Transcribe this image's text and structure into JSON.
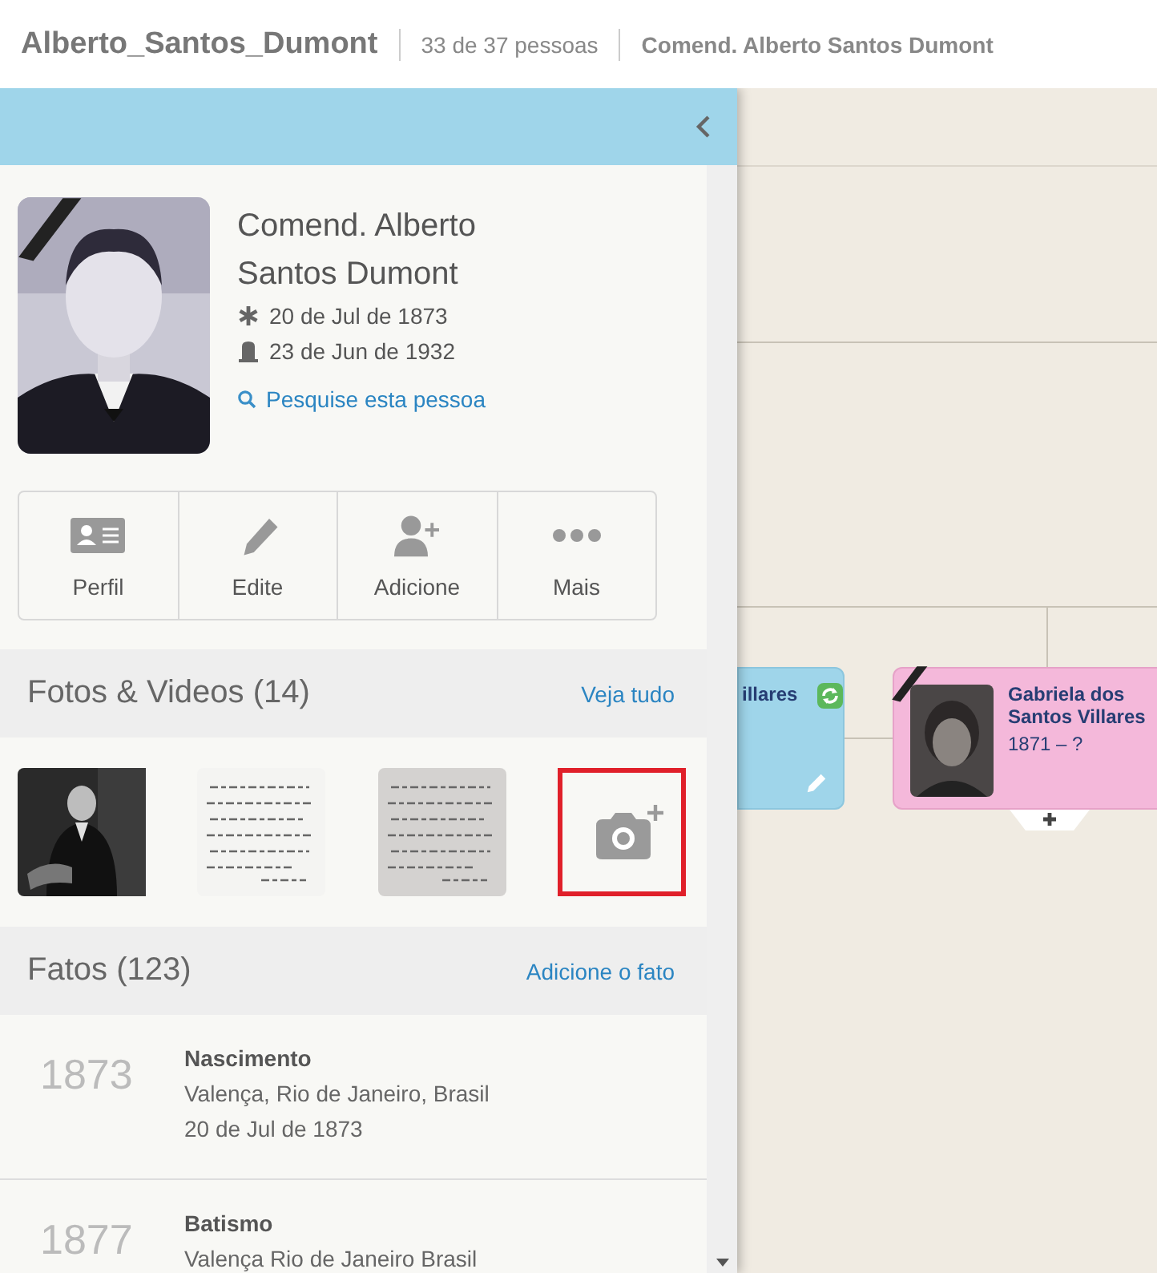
{
  "header": {
    "title": "Alberto_Santos_Dumont",
    "count": "33 de 37 pessoas",
    "person": "Comend. Alberto Santos Dumont"
  },
  "profile": {
    "name": "Comend. Alberto Santos Dumont",
    "deceased": true,
    "birth": "20 de Jul de 1873",
    "death": "23 de Jun de 1932",
    "search_link": "Pesquise esta pessoa"
  },
  "actions": [
    {
      "label": "Perfil",
      "kind": "profile"
    },
    {
      "label": "Edite",
      "kind": "edit"
    },
    {
      "label": "Adicione",
      "kind": "add"
    },
    {
      "label": "Mais",
      "kind": "more"
    }
  ],
  "photos": {
    "title": "Fotos & Videos (14)",
    "link": "Veja tudo",
    "items": [
      {
        "kind": "portrait",
        "highlighted": false
      },
      {
        "kind": "document",
        "highlighted": false
      },
      {
        "kind": "letter",
        "highlighted": false
      },
      {
        "kind": "add",
        "highlighted": true
      }
    ]
  },
  "facts": {
    "title": "Fatos (123)",
    "link": "Adicione o fato",
    "items": [
      {
        "year": "1873",
        "event": "Nascimento",
        "lines": [
          "Valença, Rio de Janeiro, Brasil",
          "20 de Jul de 1873"
        ]
      },
      {
        "year": "1877",
        "event": "Batismo",
        "lines": [
          "Valença Rio de Janeiro Brasil"
        ]
      }
    ]
  },
  "tree": {
    "cards": [
      {
        "kind": "male",
        "name": "illares",
        "deceased": false,
        "synced": true,
        "editable": true,
        "has_photo": false
      },
      {
        "kind": "female",
        "name": "Gabriela dos Santos Villares",
        "years": "1871 – ?",
        "deceased": true,
        "synced": false,
        "editable": false,
        "has_photo": true
      }
    ]
  }
}
